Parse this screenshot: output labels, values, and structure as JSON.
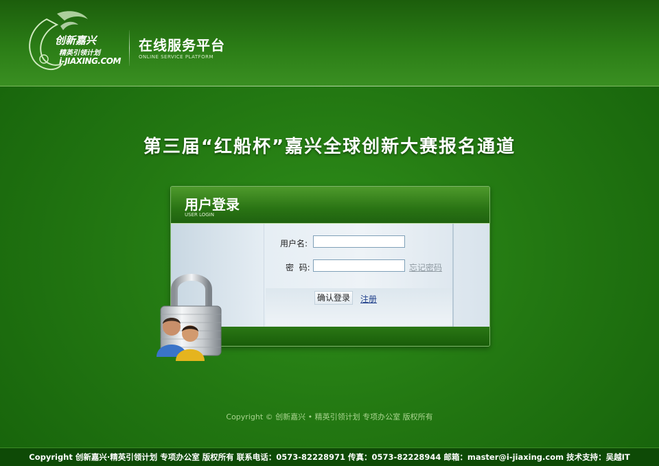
{
  "header": {
    "logo": {
      "line1": "创新嘉兴",
      "line2": "精英引领计划",
      "line3": "i-JIAXING.COM"
    },
    "platform_title": "在线服务平台",
    "platform_subtitle": "ONLINE SERVICE PLATFORM"
  },
  "page_title": "第三届“红船杯”嘉兴全球创新大赛报名通道",
  "login": {
    "title": "用户登录",
    "subtitle": "USER LOGIN",
    "username_label": "用户名:",
    "username_value": "",
    "password_label": "密  码:",
    "password_value": "",
    "forgot_label": "忘记密码",
    "submit_label": "确认登录",
    "register_label": "注册"
  },
  "copyright_mid": "Copyright ©   创新嘉兴 • 精英引领计划  专项办公室  版权所有",
  "footer": {
    "text": "Copyright 创新嘉兴·精英引领计划 专项办公室 版权所有 联系电话：0573-82228971 传真：0573-82228944 邮箱：master@i-jiaxing.com 技术支持：吴越IT"
  },
  "colors": {
    "brand_green": "#237812",
    "footer_bg": "#0e4a06",
    "link_blue": "#1f3f8a"
  }
}
